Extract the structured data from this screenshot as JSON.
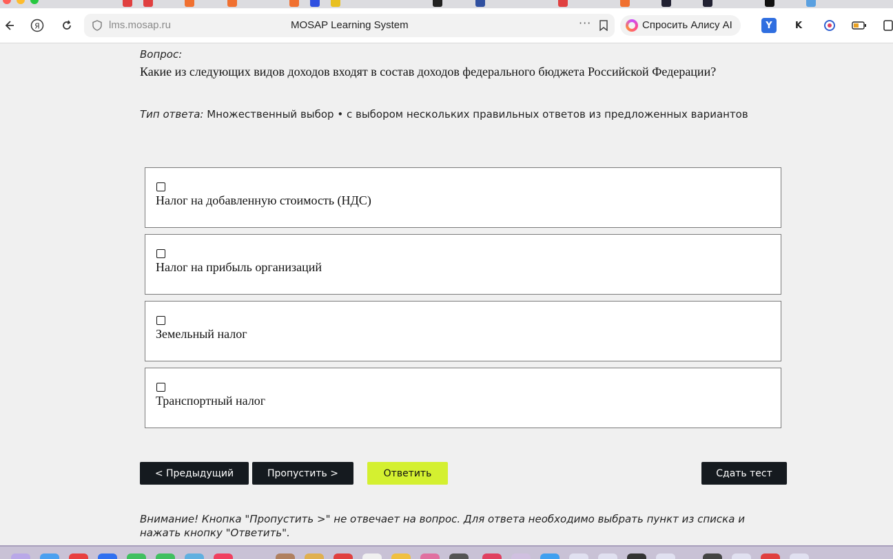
{
  "browser": {
    "url": "lms.mosap.ru",
    "page_title": "MOSAP Learning System",
    "more_label": "···",
    "alice_label": "Спросить Алису AI"
  },
  "question": {
    "label": "Вопрос:",
    "text": "Какие из следующих видов доходов входят в состав доходов федерального бюджета Российской Федерации?",
    "type_label": "Тип ответа:",
    "type_value": "Множественный выбор • с выбором нескольких правильных ответов из предложенных вариантов"
  },
  "options": [
    {
      "label": "Налог на добавленную стоимость (НДС)",
      "checked": false
    },
    {
      "label": "Налог на прибыль организаций",
      "checked": false
    },
    {
      "label": "Земельный налог",
      "checked": false
    },
    {
      "label": "Транспортный налог",
      "checked": false
    }
  ],
  "buttons": {
    "prev": "< Предыдущий",
    "skip": "Пропустить >",
    "answer": "Ответить",
    "submit": "Сдать тест"
  },
  "warning": "Внимание! Кнопка \"Пропустить >\" не отвечает на вопрос. Для ответа необходимо выбрать пункт из списка и нажать кнопку \"Ответить\".",
  "colors": {
    "page_bg": "#f0f0f0",
    "dark_button": "#151a1f",
    "answer_button": "#d4f030"
  }
}
